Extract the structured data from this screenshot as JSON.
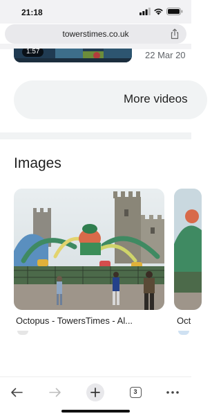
{
  "status_bar": {
    "time": "21:18",
    "icons": [
      "signal-icon",
      "wifi-icon",
      "battery-icon"
    ]
  },
  "browser": {
    "url": "towerstimes.co.uk",
    "share_icon": "share-icon"
  },
  "videos": {
    "duration": "1:57",
    "date": "22 Mar 20",
    "more_label": "More videos"
  },
  "images": {
    "heading": "Images",
    "items": [
      {
        "caption": "Octopus - TowersTimes - Al..."
      },
      {
        "caption": "Oct"
      }
    ]
  },
  "toolbar": {
    "tab_count": "3",
    "icons": [
      "back-arrow-icon",
      "forward-arrow-icon",
      "plus-icon",
      "tabs-icon",
      "more-icon"
    ]
  },
  "colors": {
    "accent_gray": "#f1f3f4",
    "text_primary": "#1f1f1f",
    "text_secondary": "#5f6368"
  }
}
